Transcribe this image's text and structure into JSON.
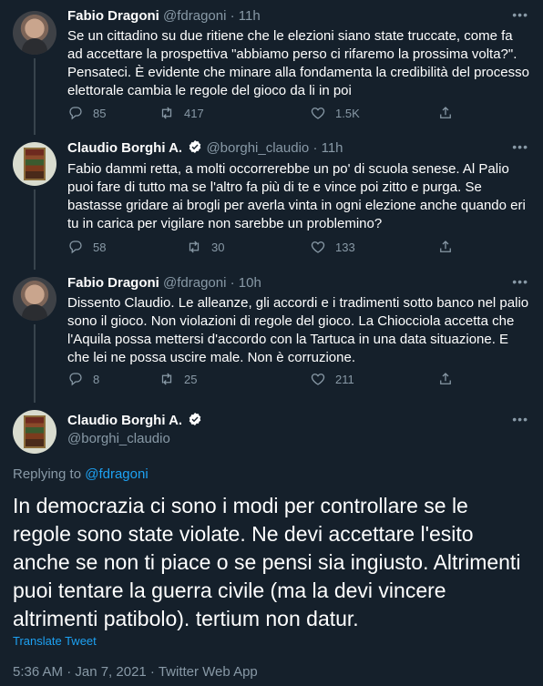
{
  "tweets": [
    {
      "name": "Fabio Dragoni",
      "handle": "@fdragoni",
      "sep": "·",
      "time": "11h",
      "text": "Se un cittadino su due ritiene che le elezioni siano state truccate, come fa ad accettare la prospettiva \"abbiamo perso ci rifaremo la prossima volta?\". Pensateci. È evidente che minare alla fondamenta la credibilità del processo elettorale cambia le regole del gioco da li in poi",
      "replies": "85",
      "retweets": "417",
      "likes": "1.5K"
    },
    {
      "name": "Claudio Borghi A.",
      "handle": "@borghi_claudio",
      "sep": "·",
      "time": "11h",
      "text": "Fabio dammi retta, a molti occorrerebbe un po' di scuola senese. Al Palio puoi fare di tutto ma se l'altro fa più di te e vince poi zitto e purga. Se bastasse gridare ai brogli per averla vinta in ogni elezione anche quando eri tu in carica per vigilare non sarebbe un problemino?",
      "replies": "58",
      "retweets": "30",
      "likes": "133"
    },
    {
      "name": "Fabio Dragoni",
      "handle": "@fdragoni",
      "sep": "·",
      "time": "10h",
      "text": "Dissento Claudio. Le alleanze, gli accordi e i tradimenti sotto banco nel palio sono il gioco. Non violazioni di regole del gioco. La Chiocciola accetta che l'Aquila possa mettersi d'accordo con la Tartuca in una data situazione. E che lei ne possa uscire male. Non è corruzione.",
      "replies": "8",
      "retweets": "25",
      "likes": "211"
    }
  ],
  "main": {
    "name": "Claudio Borghi A.",
    "handle": "@borghi_claudio",
    "replying_prefix": "Replying to",
    "replying_to": "@fdragoni",
    "text": "In democrazia ci sono i modi per controllare se le regole sono state violate. Ne devi accettare l'esito anche se non ti piace o se pensi sia ingiusto. Altrimenti puoi tentare la guerra civile (ma la devi vincere altrimenti patibolo). tertium non datur.",
    "translate": "Translate Tweet",
    "footer": "5:36 AM · Jan 7, 2021 · Twitter Web App"
  },
  "more_label": "•••",
  "icons": [
    "reply-icon",
    "retweet-icon",
    "like-icon",
    "share-icon",
    "verified-icon",
    "more-icon"
  ],
  "colors": {
    "background": "#15202b",
    "accent": "#1da1f2",
    "muted": "#8899a6",
    "divider": "#38444d"
  }
}
